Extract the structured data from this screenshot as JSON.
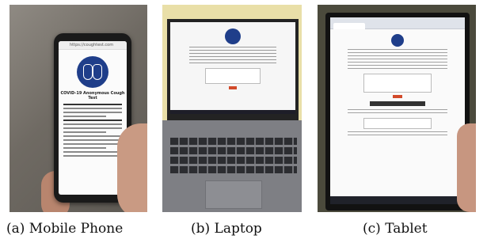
{
  "figure": {
    "panels": [
      {
        "id": "a",
        "caption": "(a) Mobile Phone",
        "screen": {
          "url": "https://coughtest.com",
          "title": "COVID-19 Anonymous Cough Test"
        }
      },
      {
        "id": "b",
        "caption": "(b) Laptop"
      },
      {
        "id": "c",
        "caption": "(c) Tablet"
      }
    ]
  }
}
